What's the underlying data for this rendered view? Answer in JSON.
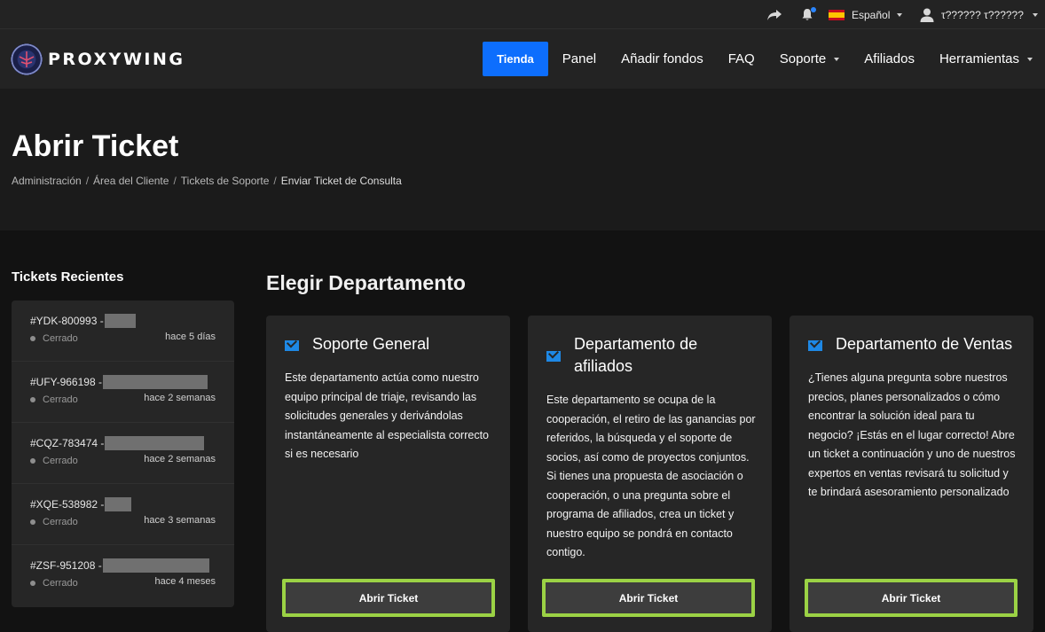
{
  "topbar": {
    "language": "Español",
    "user_name": "τ?????? τ??????"
  },
  "brand": {
    "name": "PROXYWING"
  },
  "nav": {
    "items": [
      {
        "label": "Tienda"
      },
      {
        "label": "Panel"
      },
      {
        "label": "Añadir fondos"
      },
      {
        "label": "FAQ"
      },
      {
        "label": "Soporte"
      },
      {
        "label": "Afiliados"
      },
      {
        "label": "Herramientas"
      }
    ]
  },
  "hero": {
    "title": "Abrir Ticket",
    "breadcrumb": [
      "Administración",
      "Área del Cliente",
      "Tickets de Soporte",
      "Enviar Ticket de Consulta"
    ]
  },
  "sidebar": {
    "title": "Tickets Recientes",
    "tickets": [
      {
        "id": "#YDK-800993 -",
        "status": "Cerrado",
        "time": "hace 5 días"
      },
      {
        "id": "#UFY-966198 -",
        "status": "Cerrado",
        "time": "hace 2 semanas"
      },
      {
        "id": "#CQZ-783474 -",
        "status": "Cerrado",
        "time": "hace 2 semanas"
      },
      {
        "id": "#XQE-538982 -",
        "status": "Cerrado",
        "time": "hace 3 semanas"
      },
      {
        "id": "#ZSF-951208 -",
        "status": "Cerrado",
        "time": "hace 4 meses"
      }
    ]
  },
  "departments": {
    "heading": "Elegir Departamento",
    "cards": [
      {
        "title": "Soporte General",
        "description": "Este departamento actúa como nuestro equipo principal de triaje, revisando las solicitudes generales y derivándolas instantáneamente al especialista correcto si es necesario",
        "button": "Abrir Ticket"
      },
      {
        "title": "Departamento de afiliados",
        "description": "Este departamento se ocupa de la cooperación, el retiro de las ganancias por referidos, la búsqueda y el soporte de socios, así como de proyectos conjuntos. Si tienes una propuesta de asociación o cooperación, o una pregunta sobre el programa de afiliados, crea un ticket y nuestro equipo se pondrá en contacto contigo.",
        "button": "Abrir Ticket"
      },
      {
        "title": "Departamento de Ventas",
        "description": "¿Tienes alguna pregunta sobre nuestros precios, planes personalizados o cómo encontrar la solución ideal para tu negocio? ¡Estás en el lugar correcto! Abre un ticket a continuación y uno de nuestros expertos en ventas revisará tu solicitud y te brindará asesoramiento personalizado",
        "button": "Abrir Ticket"
      }
    ]
  },
  "colors": {
    "accent": "#0d6efd",
    "highlight": "#9bd245",
    "mail_icon": "#1e88e5"
  }
}
